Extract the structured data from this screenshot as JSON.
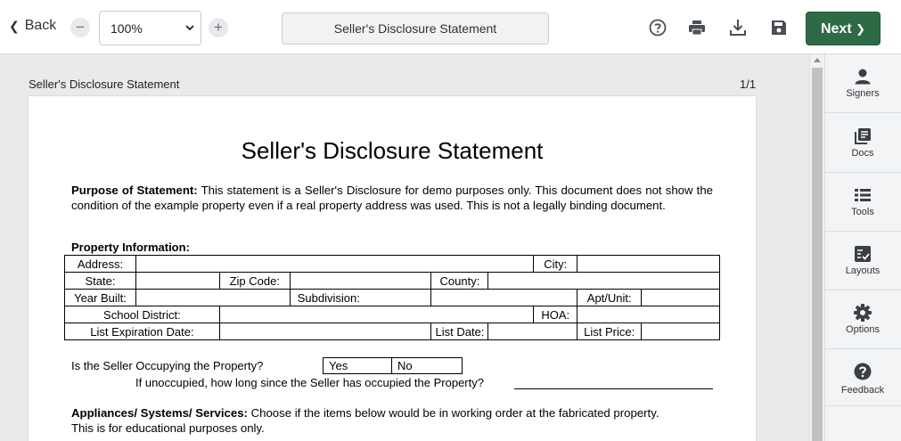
{
  "toolbar": {
    "back_label": "Back",
    "zoom_value": "100%",
    "document_title": "Seller's Disclosure Statement",
    "next_label": "Next"
  },
  "viewer": {
    "doc_name": "Seller's Disclosure Statement",
    "page_count": "1/1"
  },
  "document": {
    "title": "Seller's Disclosure Statement",
    "purpose_label": "Purpose of Statement:",
    "purpose_text": " This statement is a Seller's Disclosure for demo purposes only. This document does not show the condition of the example property even if a real property address was used. This is not a legally binding document.",
    "property_info_title": "Property Information:",
    "fields": {
      "address": "Address:",
      "city": "City:",
      "state": "State:",
      "zip": "Zip Code:",
      "county": "County:",
      "year_built": "Year Built:",
      "subdivision": "Subdivision:",
      "apt_unit": "Apt/Unit:",
      "school_district": "School District:",
      "hoa": "HOA:",
      "list_expiration": "List Expiration Date:",
      "list_date": "List Date:",
      "list_price": "List Price:"
    },
    "occupying_question": "Is the Seller Occupying the Property?",
    "yes_label": "Yes",
    "no_label": "No",
    "unoccupied_question": "If unoccupied, how long since the Seller has occupied the Property?",
    "appliances_label": "Appliances/ Systems/ Services:",
    "appliances_text": " Choose if the items below would be in working order at the fabricated property. This is for educational purposes only."
  },
  "sidebar": {
    "items": [
      {
        "label": "Signers",
        "icon": "person-icon"
      },
      {
        "label": "Docs",
        "icon": "docs-icon"
      },
      {
        "label": "Tools",
        "icon": "list-icon"
      },
      {
        "label": "Layouts",
        "icon": "layouts-icon"
      },
      {
        "label": "Options",
        "icon": "gear-icon"
      },
      {
        "label": "Feedback",
        "icon": "question-icon"
      }
    ]
  },
  "colors": {
    "accent_green": "#2e6a46",
    "viewer_bg": "#e8eaec"
  }
}
